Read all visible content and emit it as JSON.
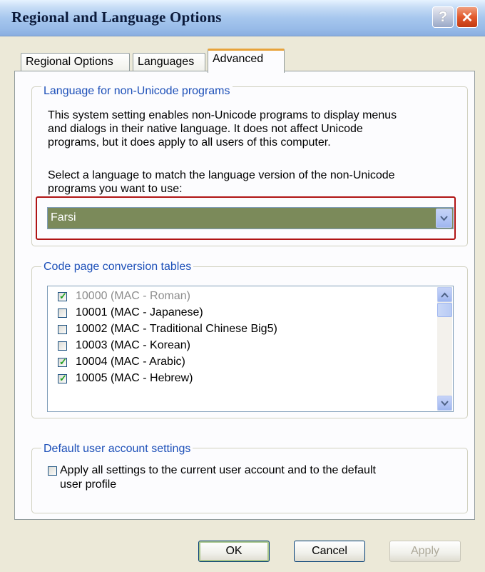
{
  "window": {
    "title": "Regional and Language Options",
    "help_glyph": "?",
    "close_glyph": "✕"
  },
  "tabs": [
    {
      "label": "Regional Options",
      "active": false
    },
    {
      "label": "Languages",
      "active": false
    },
    {
      "label": "Advanced",
      "active": true
    }
  ],
  "non_unicode": {
    "legend": "Language for non-Unicode programs",
    "description_lines": [
      "This system setting enables non-Unicode programs to display menus",
      "and dialogs in their native language. It does not affect Unicode",
      "programs, but it does apply to all users of this computer."
    ],
    "prompt_lines": [
      "Select a language to match the language version of the non-Unicode",
      "programs you want to use:"
    ],
    "selected_language": "Farsi",
    "highlight_color": "#b01414",
    "selected_bg": "#7b8a5a"
  },
  "code_pages": {
    "legend": "Code page conversion tables",
    "items": [
      {
        "label": "10000 (MAC - Roman)",
        "checked": true,
        "disabled": true
      },
      {
        "label": "10001 (MAC - Japanese)",
        "checked": false,
        "disabled": false
      },
      {
        "label": "10002 (MAC - Traditional Chinese Big5)",
        "checked": false,
        "disabled": false
      },
      {
        "label": "10003 (MAC - Korean)",
        "checked": false,
        "disabled": false
      },
      {
        "label": "10004 (MAC - Arabic)",
        "checked": true,
        "disabled": false
      },
      {
        "label": "10005 (MAC - Hebrew)",
        "checked": true,
        "disabled": false
      }
    ]
  },
  "user_account": {
    "legend": "Default user account settings",
    "option_lines": [
      "Apply all settings to the current user account and to the default",
      "user profile"
    ],
    "checked": false
  },
  "buttons": {
    "ok": "OK",
    "cancel": "Cancel",
    "apply": "Apply"
  }
}
